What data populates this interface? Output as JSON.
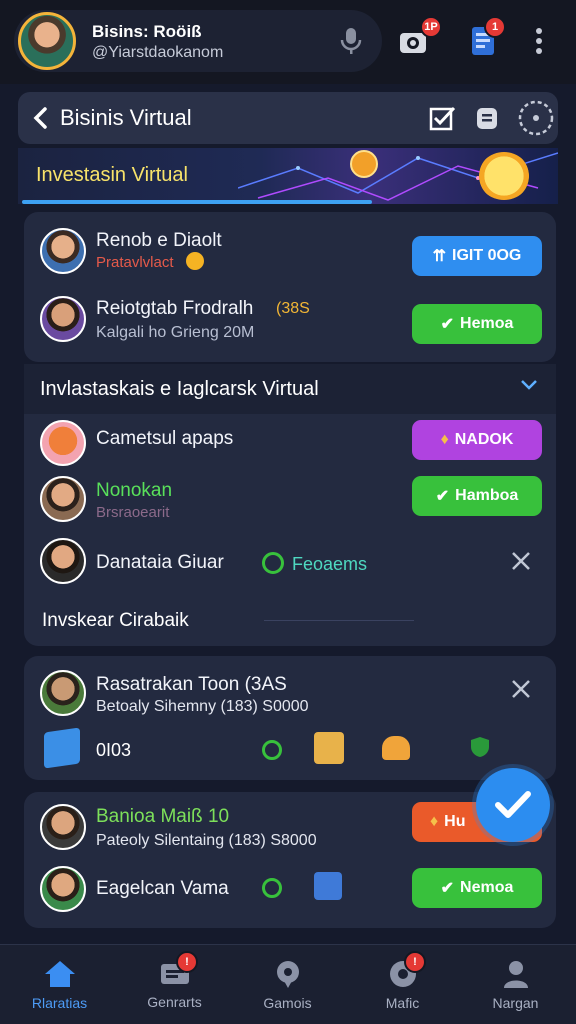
{
  "header": {
    "profile_name": "Bisins: Roöiß",
    "profile_handle": "@Yiarstdaokanom",
    "badge_camera": "1P",
    "badge_doc": "1"
  },
  "subheader": {
    "title": "Bisinis Virtual"
  },
  "hero": {
    "title": "Investasin Virtual"
  },
  "card1": {
    "row1": {
      "name": "Renob e Diaolt",
      "sub": "Pratavlvlact",
      "button": "IGIT 0OG"
    },
    "row2": {
      "name": "Reiotgtab Frodralh",
      "name_tag": "(38S",
      "sub": "Kalgali ho Grieng 20M",
      "button": "Hemoa"
    }
  },
  "section2": {
    "header": "Invlastaskais e Iaglcarsk Virtual",
    "row1": {
      "name": "Cametsul apaps",
      "button": "NADOK"
    },
    "row2": {
      "name": "Nonokan",
      "sub": "Brsraoearit",
      "button": "Hamboa"
    },
    "row3": {
      "name": "Danataia Giuar",
      "tag": "Feoaems"
    },
    "footer": "Invskear Cirabaik"
  },
  "card3": {
    "name": "Rasatrakan Toon (3AS",
    "sub": "Betoaly Sihemny (183) S0000",
    "code": "0I03"
  },
  "card4": {
    "row1": {
      "name": "Banioa Maiß 10",
      "sub": "Pateoly Silentaing (183) S8000",
      "button": "Hu"
    },
    "row2": {
      "name": "Eagelcan Vama",
      "button": "Nemoa"
    }
  },
  "nav": [
    {
      "label": "Rlaratias"
    },
    {
      "label": "Genrarts"
    },
    {
      "label": "Gamois"
    },
    {
      "label": "Mafic"
    },
    {
      "label": "Nargan"
    }
  ],
  "colors": {
    "accent": "#2f8ef0",
    "green": "#38c13c",
    "purple": "#b043e0",
    "orange": "#ea5a2a"
  }
}
